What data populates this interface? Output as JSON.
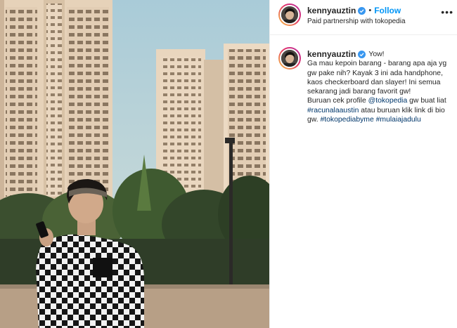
{
  "post": {
    "username": "kennyauztin",
    "follow_label": "Follow",
    "separator": "•",
    "partnership_label": "Paid partnership with tokopedia",
    "more_icon": "•••"
  },
  "caption": {
    "username": "kennyauztin",
    "first_text": "Yow!",
    "paragraph1": "Ga mau kepoin barang - barang apa aja yg gw pake nih? Kayak 3 ini ada handphone, kaos checkerboard dan slayer! Ini semua sekarang jadi barang favorit gw!",
    "p2_text1": "Buruan cek profile ",
    "p2_mention": "@tokopedia",
    "p2_text2": " gw buat liat ",
    "p2_hashtag1": "#racunalaaustin",
    "p2_text3": " atau buruan klik link di bio gw. ",
    "p2_hashtag2": "#tokopediabyme",
    "p2_hashtag3": "#mulaiajadulu"
  },
  "icons": {
    "verified": "verified-badge-icon",
    "more": "more-options-icon"
  },
  "colors": {
    "accent": "#0095f6",
    "link": "#00376b",
    "text": "#262626",
    "verified": "#3897f0"
  }
}
